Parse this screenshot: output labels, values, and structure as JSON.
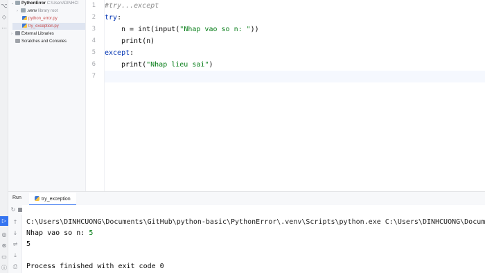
{
  "project": {
    "root_name": "PythonError",
    "root_path": "C:\\Users\\DINHCI",
    "venv_name": ".venv",
    "venv_note": "library root",
    "files": [
      "python_error.py",
      "try_exception.py"
    ],
    "external_libraries": "External Libraries",
    "scratches": "Scratches and Consoles"
  },
  "editor": {
    "line_numbers": [
      "1",
      "2",
      "3",
      "4",
      "5",
      "6",
      "7"
    ],
    "line1_comment": "#try...except",
    "line2_kw": "try",
    "line2_colon": ":",
    "line3_pre": "n = int(input(",
    "line3_str": "\"Nhap vao so n: \"",
    "line3_post": "))",
    "line4": "print(n)",
    "line5_kw": "except",
    "line5_colon": ":",
    "line6_pre": "print(",
    "line6_str": "\"Nhap lieu sai\"",
    "line6_post": ")"
  },
  "run": {
    "title": "Run",
    "tab_label": "try_exception",
    "output_path": "C:\\Users\\DINHCUONG\\Documents\\GitHub\\python-basic\\PythonError\\.venv\\Scripts\\python.exe C:\\Users\\DINHCUONG\\Documer",
    "prompt": "Nhap vao so n: ",
    "input_value": "5",
    "printed_value": "5",
    "exit_message": "Process finished with exit code 0"
  }
}
